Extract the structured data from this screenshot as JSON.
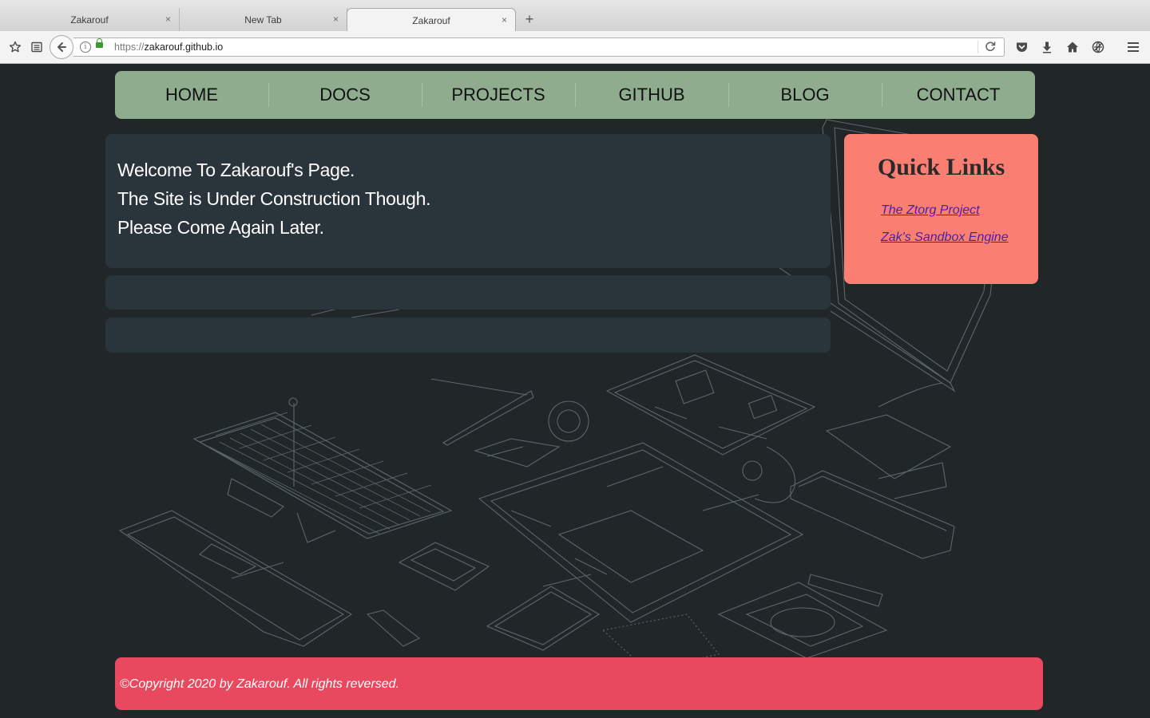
{
  "browser": {
    "tabs": [
      {
        "title": "Zakarouf",
        "active": false
      },
      {
        "title": "New Tab",
        "active": false
      },
      {
        "title": "Zakarouf",
        "active": true
      }
    ],
    "new_tab_glyph": "+",
    "close_glyph": "×",
    "url_scheme": "https://",
    "url_host": "zakarouf.github.io",
    "toolbar_icons": [
      "bookmark-star-icon",
      "reader-list-icon",
      "back-arrow-icon",
      "info-icon",
      "lock-icon",
      "reload-icon",
      "pocket-icon",
      "download-icon",
      "home-icon",
      "addons-icon",
      "menu-icon"
    ]
  },
  "site": {
    "nav": [
      "HOME",
      "DOCS",
      "PROJECTS",
      "GITHUB",
      "BLOG",
      "CONTACT"
    ],
    "welcome": {
      "line1": "Welcome To Zakarouf's Page.",
      "line2": "The Site is Under Construction Though.",
      "line3": "Please Come Again Later."
    },
    "quick_links": {
      "title": "Quick Links",
      "links": [
        "The Ztorg Project",
        "Zak's Sandbox Engine"
      ]
    },
    "footer": "©Copyright 2020 by Zakarouf. All rights reversed."
  },
  "colors": {
    "page_bg": "#212629",
    "nav_bg": "#8fac8f",
    "panel_bg": "#29343b",
    "quick_links_bg": "#fa7f72",
    "footer_bg": "#e8495f",
    "link": "#4b1fa8"
  }
}
